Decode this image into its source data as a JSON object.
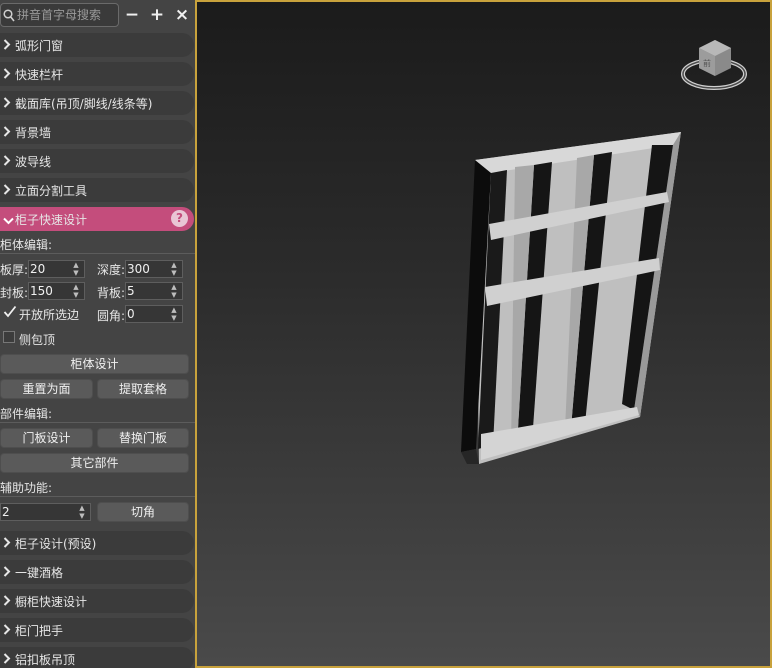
{
  "search": {
    "placeholder": "拼音首字母搜索"
  },
  "toolbar": {
    "collapse": "−",
    "expand": "+",
    "close": "×"
  },
  "rollouts_top": [
    "弧形门窗",
    "快速栏杆",
    "截面库(吊顶/脚线/线条等)",
    "背景墙",
    "波导线",
    "立面分割工具"
  ],
  "active_rollout": {
    "label": "柜子快速设计",
    "help": "?"
  },
  "cabinet": {
    "section_title": "柜体编辑:",
    "board_thickness_label": "板厚:",
    "board_thickness": "20",
    "depth_label": "深度:",
    "depth": "300",
    "seal_label": "封板:",
    "seal": "150",
    "back_label": "背板:",
    "back": "5",
    "open_selected_label": "开放所选边",
    "open_selected_checked": true,
    "corner_label": "圆角:",
    "corner": "0",
    "side_top_label": "侧包顶",
    "side_top_checked": false,
    "design_button": "柜体设计",
    "reset_button": "重置为面",
    "extract_button": "提取套格"
  },
  "parts": {
    "section_title": "部件编辑:",
    "door_design_button": "门板设计",
    "replace_door_button": "替换门板",
    "other_parts_button": "其它部件"
  },
  "assist": {
    "section_title": "辅助功能:",
    "value": "2",
    "chamfer_button": "切角"
  },
  "rollouts_bottom": [
    "柜子设计(预设)",
    "一键酒格",
    "橱柜快速设计",
    "柜门把手",
    "铝扣板吊顶"
  ],
  "viewcube": {
    "face_label": "前"
  },
  "colors": {
    "accent": "#c44d7c",
    "viewport_border": "#c8a23c",
    "panel_bg": "#444444"
  }
}
